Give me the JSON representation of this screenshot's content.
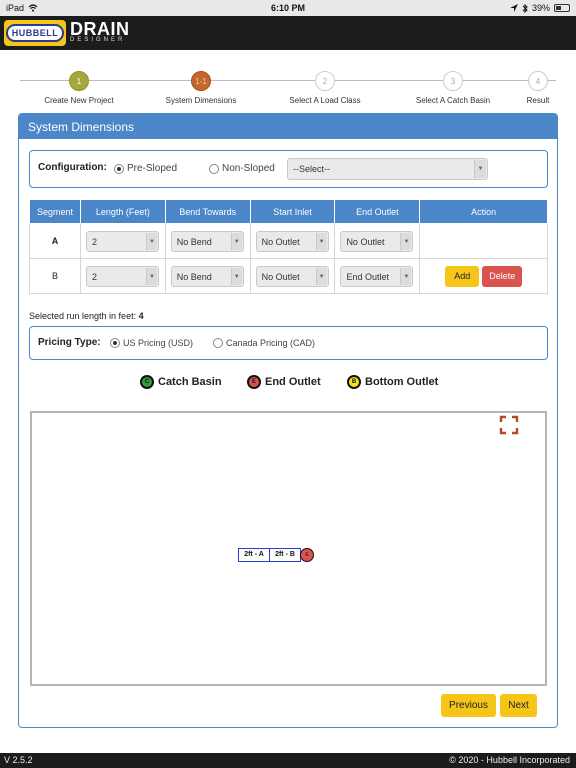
{
  "status_bar": {
    "device": "iPad",
    "time": "6:10 PM",
    "battery": "39%",
    "battery_level": 0.39
  },
  "app": {
    "logo_text": "HUBBELL",
    "title": "DRAIN",
    "subtitle": "DESIGNER"
  },
  "stepper": {
    "steps": [
      {
        "num": "1",
        "label": "Create New Project",
        "state": "done"
      },
      {
        "num": "1-1",
        "label": "System Dimensions",
        "state": "current"
      },
      {
        "num": "2",
        "label": "Select A Load Class",
        "state": "pending"
      },
      {
        "num": "3",
        "label": "Select A Catch Basin",
        "state": "pending"
      },
      {
        "num": "4",
        "label": "Result",
        "state": "pending"
      }
    ]
  },
  "panel": {
    "title": "System Dimensions"
  },
  "configuration": {
    "label": "Configuration:",
    "option_pre": "Pre-Sloped",
    "option_non": "Non-Sloped",
    "selected": "Pre-Sloped",
    "select_value": "--Select--"
  },
  "table": {
    "headers": [
      "Segment",
      "Length (Feet)",
      "Bend Towards",
      "Start Inlet",
      "End Outlet",
      "Action"
    ],
    "rows": [
      {
        "segment": "A",
        "length": "2",
        "bend": "No Bend",
        "start_inlet": "No Outlet",
        "end_outlet": "No Outlet"
      },
      {
        "segment": "B",
        "length": "2",
        "bend": "No Bend",
        "start_inlet": "No Outlet",
        "end_outlet": "End Outlet"
      }
    ],
    "add_label": "Add",
    "delete_label": "Delete"
  },
  "run_length": {
    "label": "Selected run length in feet:",
    "value": "4"
  },
  "pricing": {
    "label": "Pricing Type:",
    "option_us": "US Pricing (USD)",
    "option_ca": "Canada Pricing (CAD)",
    "selected": "US Pricing (USD)"
  },
  "legend": {
    "items": [
      {
        "label": "Catch Basin",
        "symbol": "C",
        "color": "#2e9e3e"
      },
      {
        "label": "End Outlet",
        "symbol": "E",
        "color": "#d9534f"
      },
      {
        "label": "Bottom Outlet",
        "symbol": "B",
        "color": "#f5e11a"
      }
    ]
  },
  "diagram": {
    "segments": [
      "2ft - A",
      "2ft - B"
    ],
    "end_marker": "E",
    "expand_icon": "expand-icon"
  },
  "nav": {
    "previous_label": "Previous",
    "next_label": "Next"
  },
  "footer": {
    "version": "V 2.5.2",
    "copyright": "© 2020 - Hubbell Incorporated"
  },
  "colors": {
    "primary": "#4a86c8",
    "accent": "#f5c518",
    "danger": "#d9534f"
  }
}
